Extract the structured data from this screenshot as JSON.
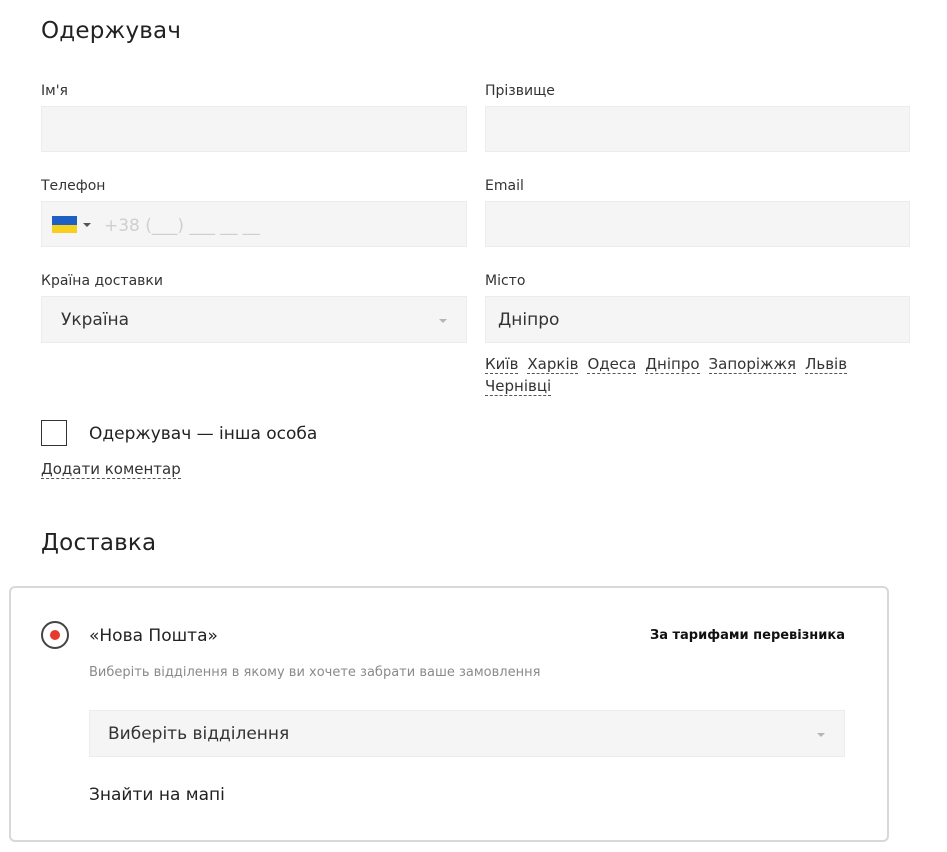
{
  "recipient": {
    "title": "Одержувач",
    "first_name": {
      "label": "Ім'я",
      "value": ""
    },
    "last_name": {
      "label": "Прізвище",
      "value": ""
    },
    "phone": {
      "label": "Телефон",
      "placeholder": "+38 (___) ___ __ __",
      "flag": "ukraine-flag-icon"
    },
    "email": {
      "label": "Email",
      "value": ""
    },
    "country": {
      "label": "Країна доставки",
      "value": "Україна"
    },
    "city": {
      "label": "Місто",
      "value": "Дніпро",
      "suggestions": [
        "Київ",
        "Харків",
        "Одеса",
        "Дніпро",
        "Запоріжжя",
        "Львів",
        "Чернівці"
      ]
    },
    "other_person_label": "Одержувач — інша особа",
    "add_comment_label": "Додати коментар"
  },
  "delivery": {
    "title": "Доставка",
    "option": {
      "name": "«Нова Пошта»",
      "price_label": "За тарифами перевізника",
      "hint": "Виберіть відділення в якому ви хочете забрати ваше замовлення",
      "select_value": "Виберіть відділення",
      "map_link": "Знайти на мапі",
      "selected": true
    }
  },
  "colors": {
    "accent": "#e8392d",
    "field_bg": "#f5f5f5",
    "card_border": "#d8d8d8"
  }
}
